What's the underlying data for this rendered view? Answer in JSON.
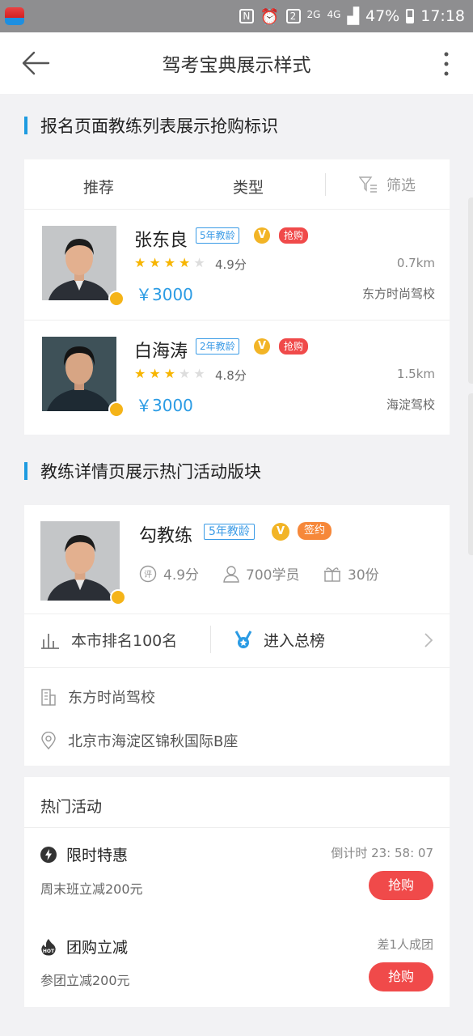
{
  "status_bar": {
    "signal_label": "2G",
    "network_label": "4G",
    "sim_badge": "2",
    "battery": "47%",
    "time": "17:18"
  },
  "nav": {
    "title": "驾考宝典展示样式"
  },
  "section1": {
    "title": "报名页面教练列表展示抢购标识"
  },
  "filters": {
    "recommend": "推荐",
    "type": "类型",
    "filter": "筛选"
  },
  "coaches": [
    {
      "name": "张东良",
      "years": "5年教龄",
      "v": "V",
      "tag": "抢购",
      "rating": 4,
      "score": "4.9分",
      "distance": "0.7km",
      "price": "￥3000",
      "school": "东方时尚驾校"
    },
    {
      "name": "白海涛",
      "years": "2年教龄",
      "v": "V",
      "tag": "抢购",
      "rating": 3,
      "score": "4.8分",
      "distance": "1.5km",
      "price": "￥3000",
      "school": "海淀驾校"
    }
  ],
  "section2": {
    "title": "教练详情页展示热门活动版块"
  },
  "detail": {
    "name": "勾教练",
    "years": "5年教龄",
    "v": "V",
    "tag": "签约",
    "score": "4.9分",
    "students": "700学员",
    "gifts": "30份",
    "rank": "本市排名100名",
    "enter_rank": "进入总榜",
    "school": "东方时尚驾校",
    "address": "北京市海淀区锦秋国际B座"
  },
  "activities": {
    "title": "热门活动",
    "items": [
      {
        "name": "限时特惠",
        "right": "倒计时 23: 58: 07",
        "desc": "周末班立减200元",
        "button": "抢购"
      },
      {
        "name": "团购立减",
        "right": "差1人成团",
        "desc": "参团立减200元",
        "button": "抢购"
      }
    ]
  },
  "colors": {
    "accent": "#1e9be0",
    "buy": "#f04a4a",
    "sign": "#f6883a",
    "star": "#f7b500"
  }
}
